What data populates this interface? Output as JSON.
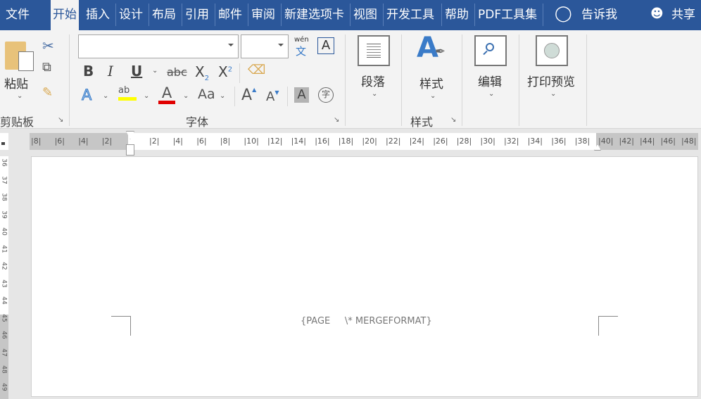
{
  "tabs": [
    {
      "label": "文件"
    },
    {
      "label": "开始"
    },
    {
      "label": "插入"
    },
    {
      "label": "设计"
    },
    {
      "label": "布局"
    },
    {
      "label": "引用"
    },
    {
      "label": "邮件"
    },
    {
      "label": "审阅"
    },
    {
      "label": "新建选项卡"
    },
    {
      "label": "视图"
    },
    {
      "label": "开发工具"
    },
    {
      "label": "帮助"
    },
    {
      "label": "PDF工具集"
    }
  ],
  "tell_me": "告诉我",
  "share": "共享",
  "clipboard": {
    "paste": "粘贴",
    "group": "剪贴板"
  },
  "font": {
    "group": "字体",
    "name_value": "",
    "size_value": "",
    "phonetic_top": "wén",
    "phonetic_bottom": "文",
    "bold": "B",
    "italic": "I",
    "underline": "U",
    "strike": "abc",
    "sub": "X",
    "sup": "X",
    "change_case": "Aa",
    "grow": "A",
    "shrink": "A",
    "shade": "A",
    "enclose": "字",
    "text_effect": "A",
    "font_color": "A",
    "highlight": "ab",
    "border": "A"
  },
  "paragraph": {
    "label": "段落"
  },
  "styles": {
    "label": "样式",
    "group": "样式"
  },
  "editing": {
    "label": "编辑"
  },
  "print_preview": {
    "label": "打印预览"
  },
  "ruler": {
    "left": [
      "8",
      "6",
      "4",
      "2"
    ],
    "main": [
      "2",
      "4",
      "6",
      "8",
      "10",
      "12",
      "14",
      "16",
      "18",
      "20",
      "22",
      "24",
      "26",
      "28",
      "30",
      "32",
      "34",
      "36",
      "38"
    ],
    "right": [
      "40",
      "42",
      "44",
      "46",
      "48"
    ]
  },
  "vruler": [
    "36",
    "37",
    "38",
    "39",
    "40",
    "41",
    "42",
    "43",
    "44",
    "45",
    "46",
    "47",
    "48",
    "49"
  ],
  "document": {
    "footer_field": "{PAGE     \\* MERGEFORMAT}"
  },
  "colors": {
    "accent": "#2b579a",
    "highlight": "#ffff00",
    "font_color": "#e00000"
  }
}
